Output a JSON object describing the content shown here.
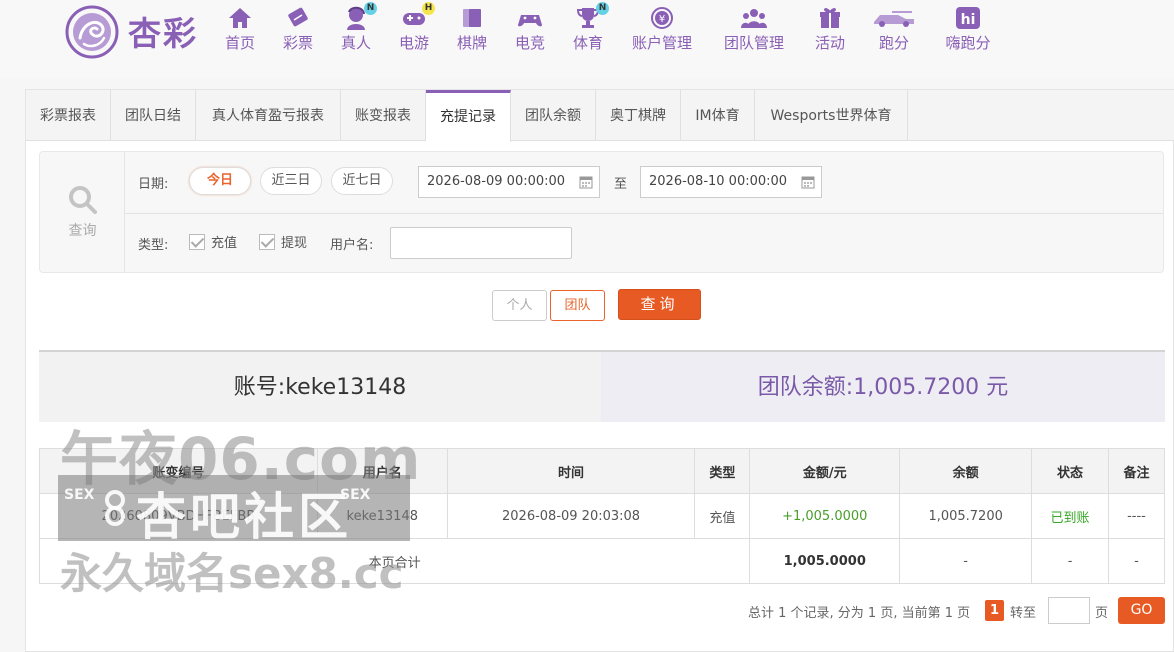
{
  "brand": {
    "name": "杏彩"
  },
  "nav": [
    {
      "label": "首页",
      "icon": "home-icon",
      "badge": ""
    },
    {
      "label": "彩票",
      "icon": "lottery-ticket-icon",
      "badge": ""
    },
    {
      "label": "真人",
      "icon": "live-dealer-icon",
      "badge": "N"
    },
    {
      "label": "电游",
      "icon": "gamepad-icon",
      "badge": "H"
    },
    {
      "label": "棋牌",
      "icon": "cards-icon",
      "badge": ""
    },
    {
      "label": "电竞",
      "icon": "esports-controller-icon",
      "badge": ""
    },
    {
      "label": "体育",
      "icon": "trophy-icon",
      "badge": "N"
    },
    {
      "label": "账户管理",
      "icon": "yen-coin-icon",
      "badge": ""
    },
    {
      "label": "团队管理",
      "icon": "team-icon",
      "badge": ""
    },
    {
      "label": "活动",
      "icon": "gift-icon",
      "badge": ""
    },
    {
      "label": "跑分",
      "icon": "race-car-icon",
      "badge": ""
    },
    {
      "label": "嗨跑分",
      "icon": "hi-app-icon",
      "badge": ""
    }
  ],
  "tabs": [
    {
      "label": "彩票报表",
      "active": false
    },
    {
      "label": "团队日结",
      "active": false
    },
    {
      "label": "真人体育盈亏报表",
      "active": false
    },
    {
      "label": "账变报表",
      "active": false
    },
    {
      "label": "充提记录",
      "active": true
    },
    {
      "label": "团队余额",
      "active": false
    },
    {
      "label": "奥丁棋牌",
      "active": false
    },
    {
      "label": "IM体育",
      "active": false
    },
    {
      "label": "Wesports世界体育",
      "active": false
    }
  ],
  "search": {
    "side_label": "查询",
    "date_label": "日期:",
    "quick_dates": [
      "今日",
      "近三日",
      "近七日"
    ],
    "date_from": "2026-08-09 00:00:00",
    "date_sep": "至",
    "date_to": "2026-08-10 00:00:00",
    "type_label": "类型:",
    "types": [
      "充值",
      "提现"
    ],
    "username_label": "用户名:",
    "username_value": "",
    "btn_personal": "个人",
    "btn_team": "团队",
    "btn_query": "查询"
  },
  "summary": {
    "account_label": "账号:",
    "account": "keke13148",
    "balance_label": "团队余额:",
    "balance": "1,005.7200",
    "balance_unit": "元"
  },
  "table": {
    "columns": [
      "账变编号",
      "用户名",
      "时间",
      "类型",
      "金额/元",
      "余额",
      "状态",
      "备注"
    ],
    "rows": [
      {
        "id": "20260809VBDHFBEFBB",
        "user": "keke13148",
        "time": "2026-08-09 20:03:08",
        "type": "充值",
        "amount": "+1,005.0000",
        "balance": "1,005.7200",
        "status": "已到账",
        "note": "----"
      }
    ],
    "total_label": "本页合计",
    "total_amount": "1,005.0000",
    "total_balance": "-",
    "total_status": "-",
    "total_note": "-"
  },
  "pager": {
    "summary": "总计 1 个记录, 分为 1 页, 当前第 1 页",
    "current": "1",
    "goto_label": "转至",
    "page_unit": "页",
    "go": "GO"
  },
  "watermark": {
    "line1": "午夜06.com",
    "line2": "杏吧社区",
    "tag": "SEX",
    "line3": "永久域名sex8.cc"
  },
  "colors": {
    "brand_purple": "#8a5fb6",
    "accent_orange": "#e85a24",
    "success_green": "#35a825"
  }
}
